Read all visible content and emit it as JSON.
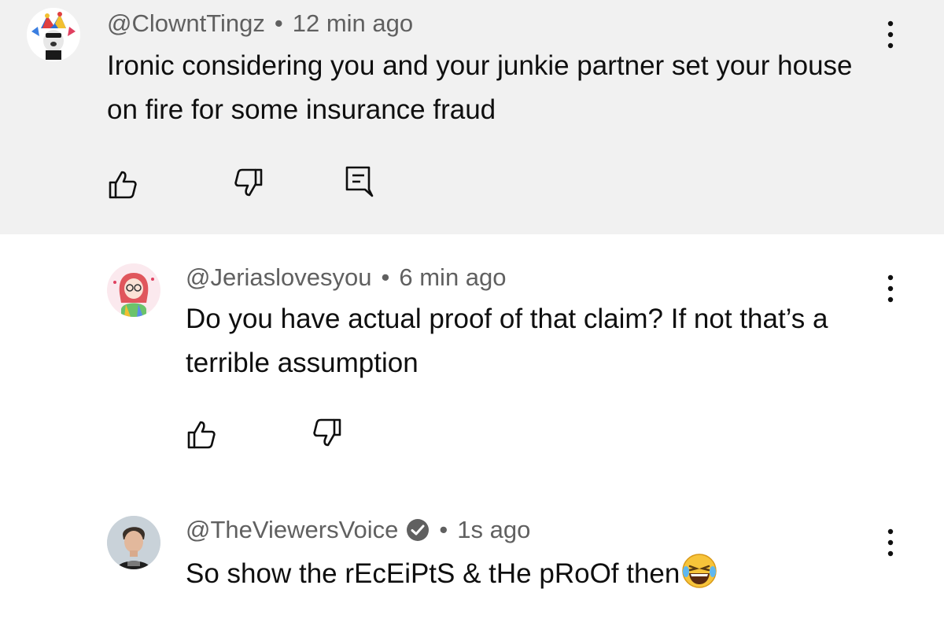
{
  "comments": [
    {
      "handle": "@ClowntTingz",
      "time": "12 min ago",
      "text": "Ironic considering you and your junkie partner set your house on fire for some insurance fraud",
      "avatar_icon": "jester-dog-avatar"
    },
    {
      "handle": "@Jeriaslovesyou",
      "time": "6 min ago",
      "text": "Do you have actual proof of that claim? If not that’s a terrible assumption",
      "avatar_icon": "anime-girl-avatar"
    },
    {
      "handle": "@TheViewersVoice",
      "time": "1s ago",
      "text": "So show the rEcEiPtS & tHe pRoOf then",
      "avatar_icon": "man-avatar",
      "verified": true
    }
  ],
  "separator": "•",
  "colors": {
    "highlight_bg": "#f1f1f1",
    "meta_text": "#606060",
    "body_text": "#0f0f0f"
  }
}
